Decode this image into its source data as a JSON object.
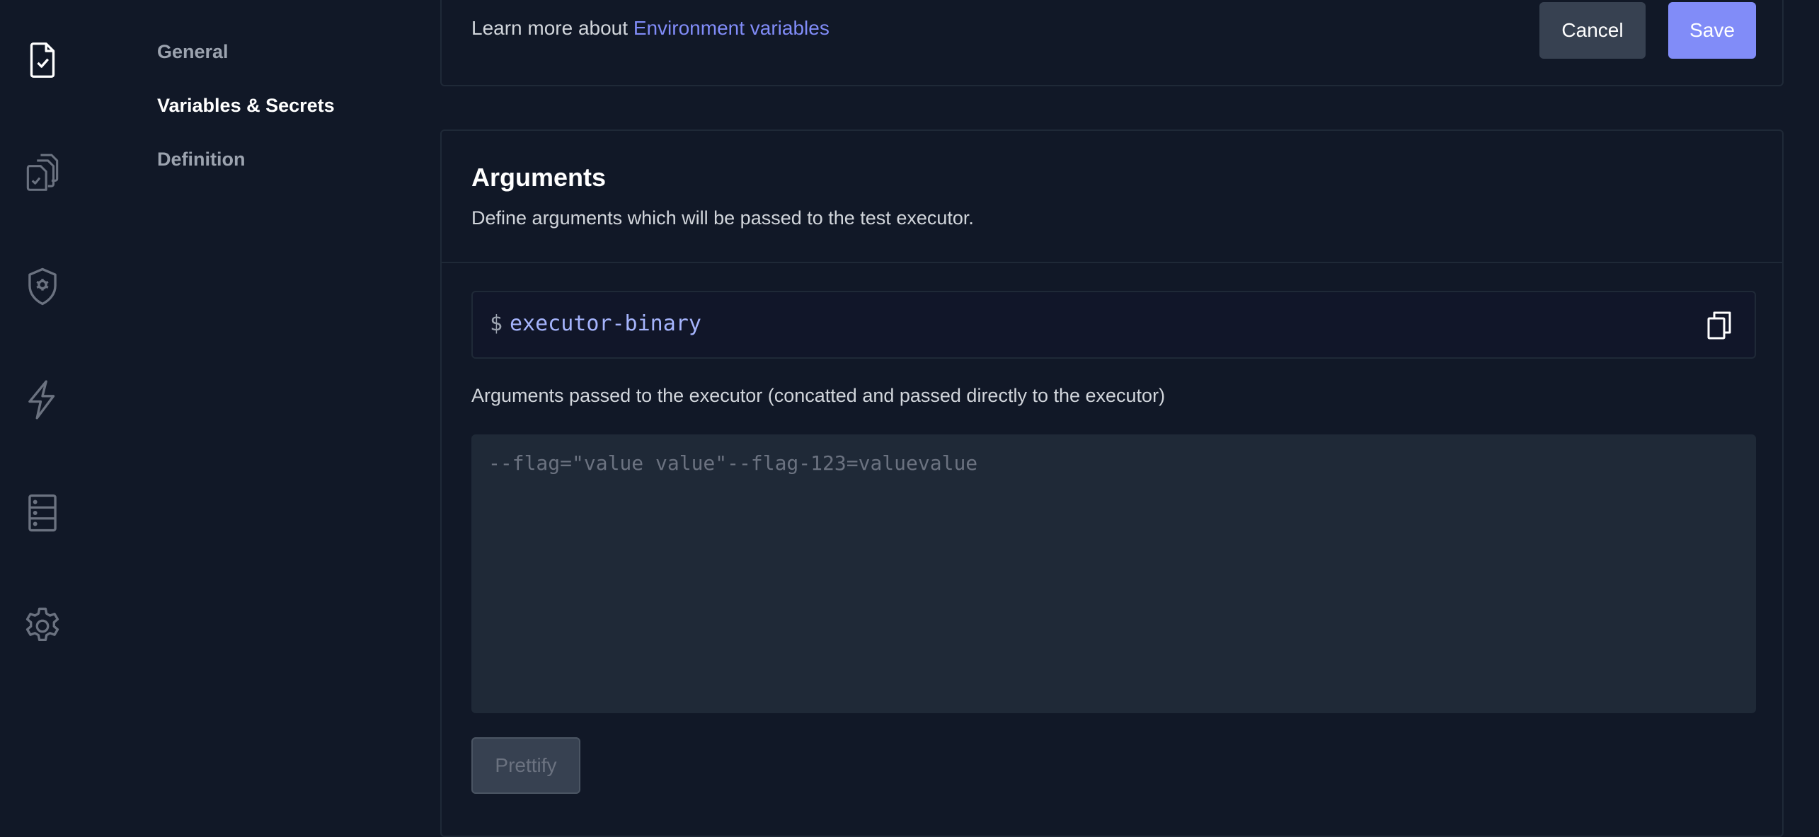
{
  "rail": {
    "icons": [
      "test-file-icon",
      "test-suites-icon",
      "executors-icon",
      "triggers-icon",
      "sources-icon",
      "settings-icon"
    ]
  },
  "subnav": {
    "items": [
      {
        "label": "General",
        "active": false
      },
      {
        "label": "Variables & Secrets",
        "active": true
      },
      {
        "label": "Definition",
        "active": false
      }
    ]
  },
  "top_card": {
    "learn_prefix": "Learn more about ",
    "learn_link": "Environment variables",
    "cancel_label": "Cancel",
    "save_label": "Save"
  },
  "arguments": {
    "title": "Arguments",
    "description": "Define arguments which will be passed to the test executor.",
    "prompt_symbol": "$",
    "command": "executor-binary",
    "field_label": "Arguments passed to the executor (concatted and passed directly to the executor)",
    "placeholder": "--flag=\"value value\"--flag-123=valuevalue",
    "prettify_label": "Prettify"
  },
  "colors": {
    "background": "#111827",
    "accent": "#818cf8",
    "card_border": "#1f2937",
    "secondary_button": "#374151"
  }
}
